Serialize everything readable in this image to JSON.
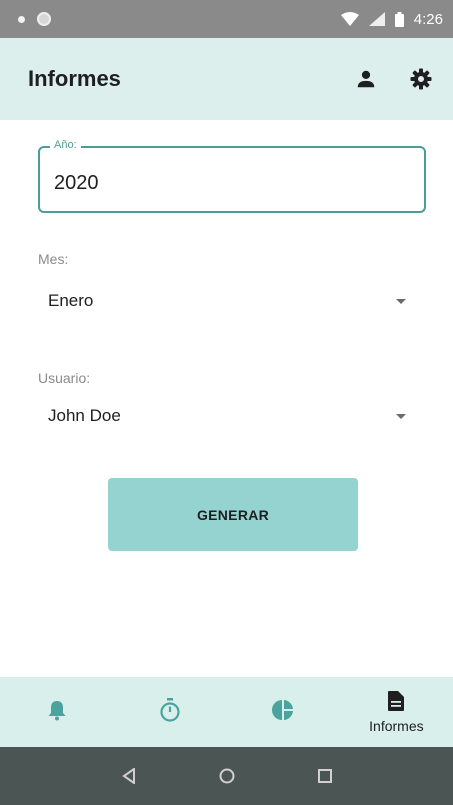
{
  "status_bar": {
    "time": "4:26"
  },
  "app_bar": {
    "title": "Informes"
  },
  "year_field": {
    "label": "Año:",
    "value": "2020"
  },
  "month_field": {
    "label": "Mes:",
    "value": "Enero"
  },
  "user_field": {
    "label": "Usuario:",
    "value": "John Doe"
  },
  "generate_button": {
    "label": "GENERAR"
  },
  "bottom_nav": {
    "items": [
      {
        "icon": "bell-icon",
        "label": ""
      },
      {
        "icon": "stopwatch-icon",
        "label": ""
      },
      {
        "icon": "pie-chart-icon",
        "label": ""
      },
      {
        "icon": "document-icon",
        "label": "Informes"
      }
    ]
  },
  "colors": {
    "accent": "#4e9c97",
    "app_bar_bg": "#dcefec",
    "button_bg": "#94d3d0",
    "icon_teal": "#4aa39d"
  }
}
